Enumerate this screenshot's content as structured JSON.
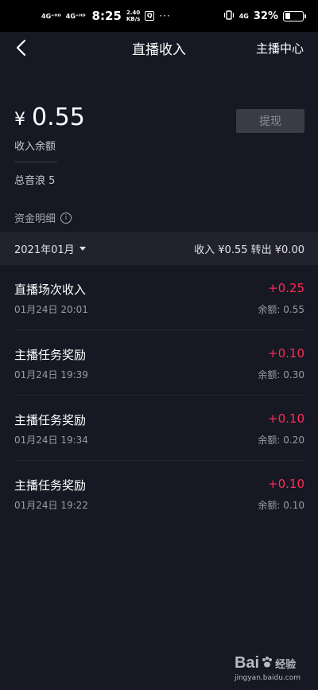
{
  "status_bar": {
    "signal1": "4G⁺ᴴᴰ",
    "signal2": "4G⁺ᴴᴰ",
    "time": "8:25",
    "speed_value": "2.40",
    "speed_unit": "KB/s",
    "app_icon_text": "Q",
    "dots": "···",
    "network": "4G",
    "battery_pct": "32%",
    "battery_level": 0.32
  },
  "header": {
    "title": "直播收入",
    "right_link": "主播中心"
  },
  "balance": {
    "currency": "¥",
    "amount": "0.55",
    "label": "收入余额",
    "withdraw_label": "提现"
  },
  "total_sound": "总音浪 5",
  "details": {
    "title": "资金明细",
    "info_icon": "i"
  },
  "month_bar": {
    "month": "2021年01月",
    "summary": "收入 ¥0.55  转出 ¥0.00"
  },
  "records": [
    {
      "title": "直播场次收入",
      "time": "01月24日 20:01",
      "change": "+0.25",
      "balance": "余额: 0.55"
    },
    {
      "title": "主播任务奖励",
      "time": "01月24日 19:39",
      "change": "+0.10",
      "balance": "余额: 0.30"
    },
    {
      "title": "主播任务奖励",
      "time": "01月24日 19:34",
      "change": "+0.10",
      "balance": "余额: 0.20"
    },
    {
      "title": "主播任务奖励",
      "time": "01月24日 19:22",
      "change": "+0.10",
      "balance": "余额: 0.10"
    }
  ],
  "watermark": {
    "logo": "Bai",
    "logo_suffix": "经验",
    "url": "jingyan.baidu.com"
  },
  "colors": {
    "background": "#161823",
    "accent_red": "#fe2c55",
    "month_bar_bg": "#21222d"
  }
}
